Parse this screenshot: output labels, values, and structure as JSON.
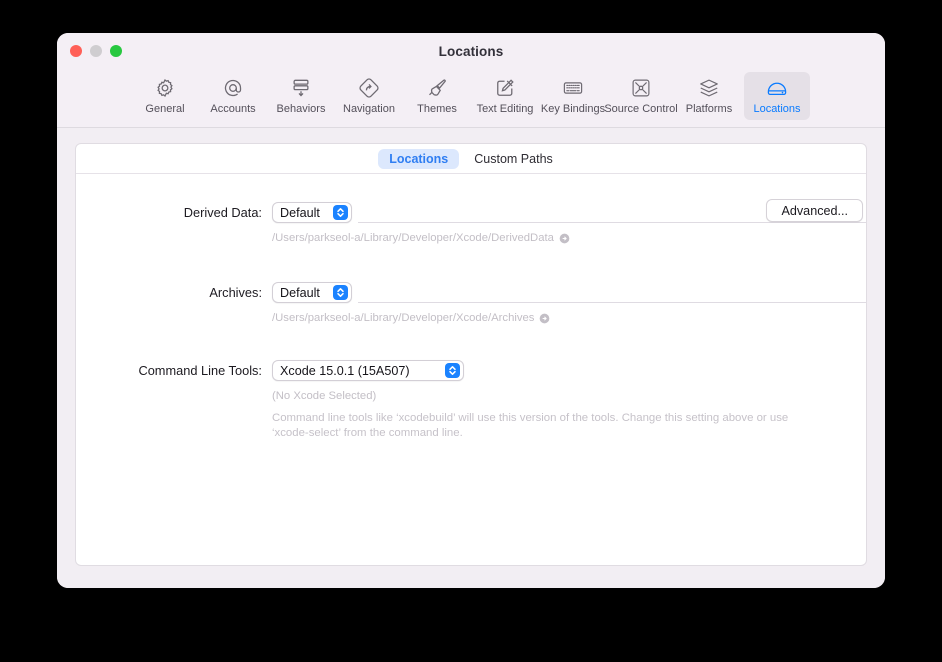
{
  "window": {
    "title": "Locations",
    "traffic_lights": [
      "close-button",
      "minimize-button",
      "zoom-button"
    ]
  },
  "toolbar": {
    "items": [
      {
        "label": "General",
        "icon": "gear-icon",
        "selected": false
      },
      {
        "label": "Accounts",
        "icon": "at-sign-icon",
        "selected": false
      },
      {
        "label": "Behaviors",
        "icon": "behaviors-icon",
        "selected": false
      },
      {
        "label": "Navigation",
        "icon": "navigation-icon",
        "selected": false
      },
      {
        "label": "Themes",
        "icon": "paintbrush-icon",
        "selected": false
      },
      {
        "label": "Text Editing",
        "icon": "pencil-square-icon",
        "selected": false
      },
      {
        "label": "Key Bindings",
        "icon": "keyboard-icon",
        "selected": false
      },
      {
        "label": "Source Control",
        "icon": "source-control-icon",
        "selected": false
      },
      {
        "label": "Platforms",
        "icon": "layers-icon",
        "selected": false
      },
      {
        "label": "Locations",
        "icon": "drive-icon",
        "selected": true
      }
    ]
  },
  "tabs": [
    {
      "label": "Locations",
      "active": true
    },
    {
      "label": "Custom Paths",
      "active": false
    }
  ],
  "form": {
    "derived_data": {
      "label": "Derived Data:",
      "popup_value": "Default",
      "textfield_value": "",
      "path": "/Users/parkseol-a/Library/Developer/Xcode/DerivedData",
      "advanced_button": "Advanced..."
    },
    "archives": {
      "label": "Archives:",
      "popup_value": "Default",
      "textfield_value": "",
      "path": "/Users/parkseol-a/Library/Developer/Xcode/Archives"
    },
    "command_line_tools": {
      "label": "Command Line Tools:",
      "popup_value": "Xcode 15.0.1 (15A507)",
      "status": "(No Xcode Selected)",
      "help": "Command line tools like ‘xcodebuild’ will use this version of the tools. Change this setting above or use ‘xcode-select’ from the command line."
    }
  },
  "colors": {
    "accent": "#0a7bff",
    "tab_active_bg": "#dce8fd",
    "tab_active_fg": "#2f7ef2",
    "popup_chevron": "#1b83ff",
    "window_bg": "#f2eef3",
    "toolbar_bg": "#f4eff5",
    "panel_bg": "#ffffff",
    "traffic_close": "#ff5f57",
    "traffic_min": "#cfcdd0",
    "traffic_zoom": "#28c840"
  }
}
